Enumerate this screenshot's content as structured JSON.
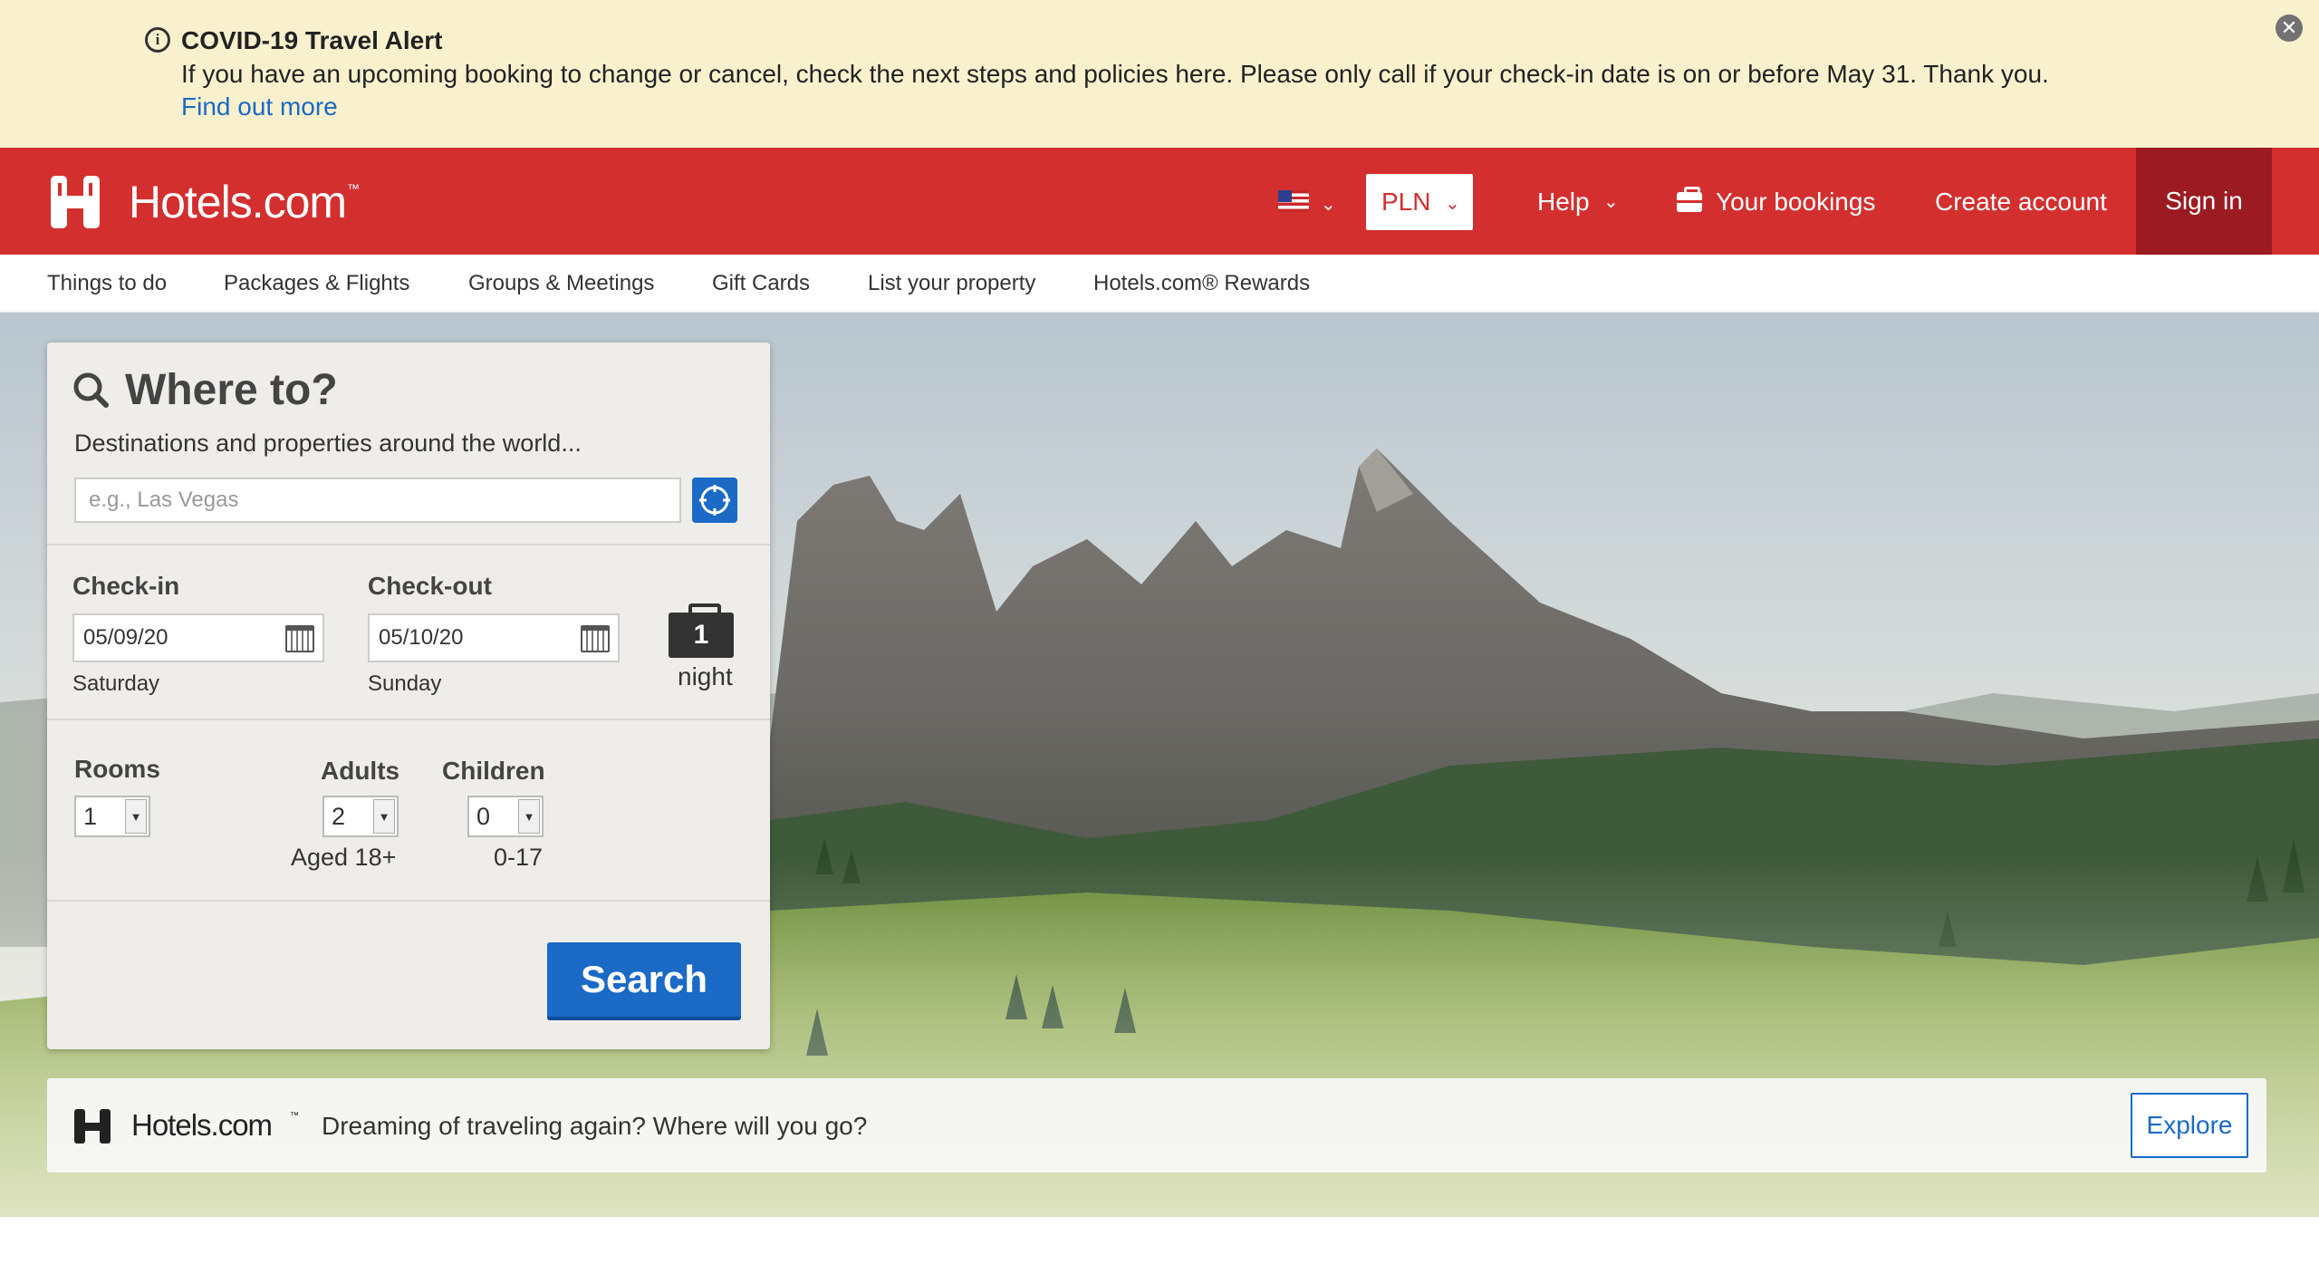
{
  "alert": {
    "title": "COVID-19 Travel Alert",
    "message": "If you have an upcoming booking to change or cancel, check the next steps and policies here. Please only call if your check-in date is on or before May 31. Thank you.",
    "link": "Find out more",
    "close": "✕",
    "info": "i"
  },
  "header": {
    "logo": "Hotels.com",
    "logo_tm": "™",
    "currency": "PLN",
    "help": "Help",
    "bookings": "Your bookings",
    "create_account": "Create account",
    "sign_in": "Sign in",
    "brand_color": "#d32f2f",
    "signin_color": "#9c1b23",
    "caret": "⌄"
  },
  "subnav": {
    "items": [
      "Things to do",
      "Packages & Flights",
      "Groups & Meetings",
      "Gift Cards",
      "List your property",
      "Hotels.com® Rewards"
    ]
  },
  "search": {
    "title": "Where to?",
    "subtitle": "Destinations and properties around the world...",
    "destination_placeholder": "e.g., Las Vegas",
    "destination_value": "",
    "checkin_label": "Check-in",
    "checkin_value": "05/09/20",
    "checkin_day": "Saturday",
    "checkout_label": "Check-out",
    "checkout_value": "05/10/20",
    "checkout_day": "Sunday",
    "nights_value": "1",
    "nights_label": "night",
    "rooms_label": "Rooms",
    "rooms_value": "1",
    "adults_label": "Adults",
    "adults_value": "2",
    "adults_note": "Aged 18+",
    "children_label": "Children",
    "children_value": "0",
    "children_note": "0-17",
    "search_button": "Search",
    "accent_color": "#1a6ac6"
  },
  "promo": {
    "logo": "Hotels.com",
    "logo_tm": "™",
    "message": "Dreaming of traveling again? Where will you go?",
    "explore": "Explore"
  },
  "icons": [
    "info-icon",
    "close-icon",
    "hotels-logo-icon",
    "us-flag-icon",
    "chevron-down-icon",
    "briefcase-icon",
    "search-icon",
    "locate-icon",
    "calendar-icon",
    "suitcase-icon"
  ]
}
